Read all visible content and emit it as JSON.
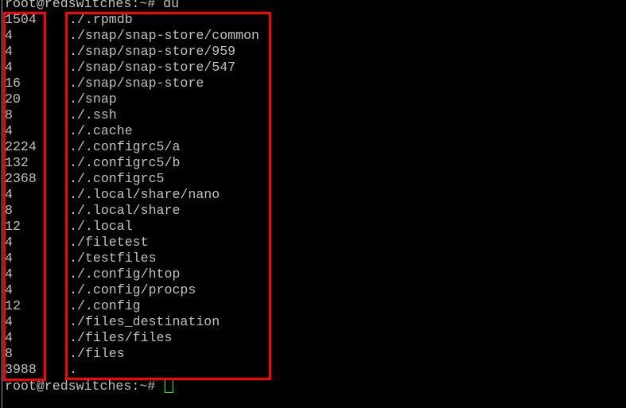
{
  "terminal": {
    "prompt": "root@redswitches:~#",
    "command": "du",
    "rows": [
      {
        "size": "1504",
        "path": "./.rpmdb"
      },
      {
        "size": "4",
        "path": "./snap/snap-store/common"
      },
      {
        "size": "4",
        "path": "./snap/snap-store/959"
      },
      {
        "size": "4",
        "path": "./snap/snap-store/547"
      },
      {
        "size": "16",
        "path": "./snap/snap-store"
      },
      {
        "size": "20",
        "path": "./snap"
      },
      {
        "size": "8",
        "path": "./.ssh"
      },
      {
        "size": "4",
        "path": "./.cache"
      },
      {
        "size": "2224",
        "path": "./.configrc5/a"
      },
      {
        "size": "132",
        "path": "./.configrc5/b"
      },
      {
        "size": "2368",
        "path": "./.configrc5"
      },
      {
        "size": "4",
        "path": "./.local/share/nano"
      },
      {
        "size": "8",
        "path": "./.local/share"
      },
      {
        "size": "12",
        "path": "./.local"
      },
      {
        "size": "4",
        "path": "./filetest"
      },
      {
        "size": "4",
        "path": "./testfiles"
      },
      {
        "size": "4",
        "path": "./.config/htop"
      },
      {
        "size": "4",
        "path": "./.config/procps"
      },
      {
        "size": "12",
        "path": "./.config"
      },
      {
        "size": "4",
        "path": "./files_destination"
      },
      {
        "size": "4",
        "path": "./files/files"
      },
      {
        "size": "8",
        "path": "./files"
      },
      {
        "size": "3988",
        "path": "."
      }
    ],
    "colors": {
      "text": "#c0c0c0",
      "background": "#000000",
      "highlight_box": "#ff0000",
      "cursor": "#00ff00"
    }
  }
}
